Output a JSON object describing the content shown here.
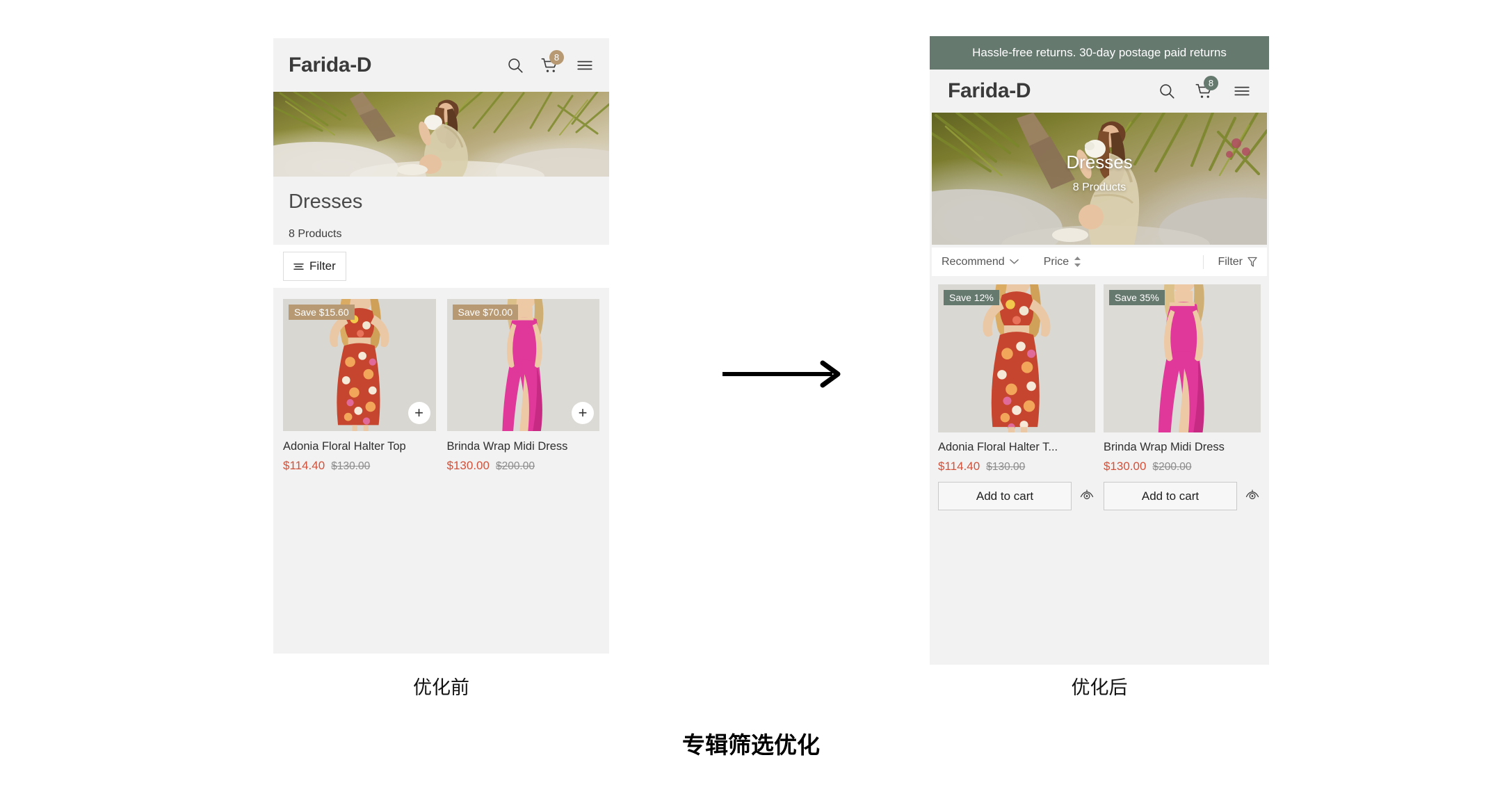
{
  "meta": {
    "bottom_title": "专辑筛选优化",
    "caption_before": "优化前",
    "caption_after": "优化后",
    "arrow_icon": "arrow-right-icon"
  },
  "colors": {
    "page_bg": "#ffffff",
    "phone_bg": "#f2f2f2",
    "sage_green": "#66796f",
    "tan": "#b79a73",
    "sale_red": "#d1513a",
    "strike_gray": "#8b8b8b",
    "text_dark": "#2e2e2e"
  },
  "before": {
    "header": {
      "brand": "Farida-D",
      "search_icon": "search-icon",
      "cart_icon": "cart-icon",
      "cart_count": "8",
      "cart_badge_color": "#b79a73",
      "menu_icon": "hamburger-menu-icon"
    },
    "hero": {
      "alt": "woman in floral dress among palm fronds"
    },
    "collection": {
      "title": "Dresses",
      "product_count": "8 Products"
    },
    "filter": {
      "label": "Filter",
      "icon": "filter-lines-icon"
    },
    "products": [
      {
        "badge": "Save $15.60",
        "badge_color": "#b79a73",
        "name": "Adonia Floral Halter Top",
        "sale_price": "$114.40",
        "original_price": "$130.00",
        "quick_add_icon": "plus-icon",
        "image_alt": "model in orange pink floral halter top and midi skirt"
      },
      {
        "badge": "Save $70.00",
        "badge_color": "#b79a73",
        "name": "Brinda Wrap Midi Dress",
        "sale_price": "$130.00",
        "original_price": "$200.00",
        "quick_add_icon": "plus-icon",
        "image_alt": "model in magenta wrap midi dress"
      }
    ]
  },
  "after": {
    "announcement": {
      "text": "Hassle-free returns. 30-day postage paid returns",
      "bg_color": "#66796f"
    },
    "header": {
      "brand": "Farida-D",
      "search_icon": "search-icon",
      "cart_icon": "cart-icon",
      "cart_count": "8",
      "cart_badge_color": "#66796f",
      "menu_icon": "hamburger-menu-icon"
    },
    "hero": {
      "title": "Dresses",
      "subtitle": "8 Products",
      "alt": "woman in floral dress among palm fronds"
    },
    "sortbar": {
      "sort_label": "Recommend",
      "sort_icon": "chevron-down-icon",
      "price_label": "Price",
      "price_icon": "sort-updown-icon",
      "filter_label": "Filter",
      "filter_icon": "funnel-icon"
    },
    "products": [
      {
        "badge": "Save 12%",
        "badge_color": "#66796f",
        "name": "Adonia Floral Halter T...",
        "sale_price": "$114.40",
        "original_price": "$130.00",
        "add_to_cart": "Add to cart",
        "quick_view_icon": "eye-icon",
        "image_alt": "model in orange pink floral halter top and midi skirt"
      },
      {
        "badge": "Save 35%",
        "badge_color": "#66796f",
        "name": "Brinda Wrap Midi Dress",
        "sale_price": "$130.00",
        "original_price": "$200.00",
        "add_to_cart": "Add to cart",
        "quick_view_icon": "eye-icon",
        "image_alt": "model in magenta wrap midi dress"
      }
    ]
  }
}
